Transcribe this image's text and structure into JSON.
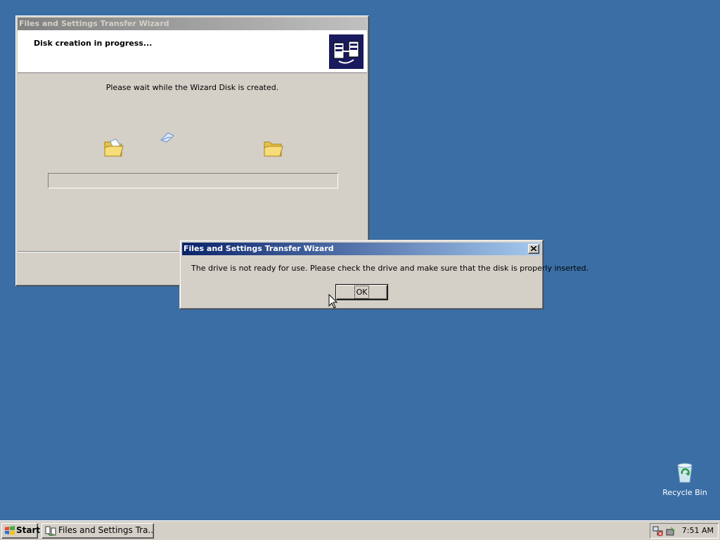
{
  "wizard": {
    "title": "Files and Settings Transfer Wizard",
    "header_title": "Disk creation in progress...",
    "header_icon": "transfer-wizard-icon",
    "message": "Please wait while the Wizard Disk is created.",
    "progress_fraction": 0.0
  },
  "dialog": {
    "title": "Files and Settings Transfer Wizard",
    "message": "The drive is not ready for use. Please check the drive and make sure that the disk is properly inserted.",
    "ok_label": "OK"
  },
  "desktop": {
    "background_color": "#3a6ea5",
    "icons": [
      {
        "label": "Recycle Bin",
        "icon": "recycle-bin-icon"
      }
    ]
  },
  "taskbar": {
    "start_label": "Start",
    "tasks": [
      {
        "label": "Files and Settings Tra...",
        "icon": "wizard-app-icon"
      }
    ],
    "tray_icons": [
      "network-icon",
      "safely-remove-icon"
    ],
    "clock": "7:51 AM"
  },
  "colors": {
    "active_title_start": "#0a246a",
    "active_title_end": "#a6caf0",
    "inactive_title_start": "#808080",
    "inactive_title_end": "#c0c0c0",
    "face": "#d4d0c8"
  }
}
